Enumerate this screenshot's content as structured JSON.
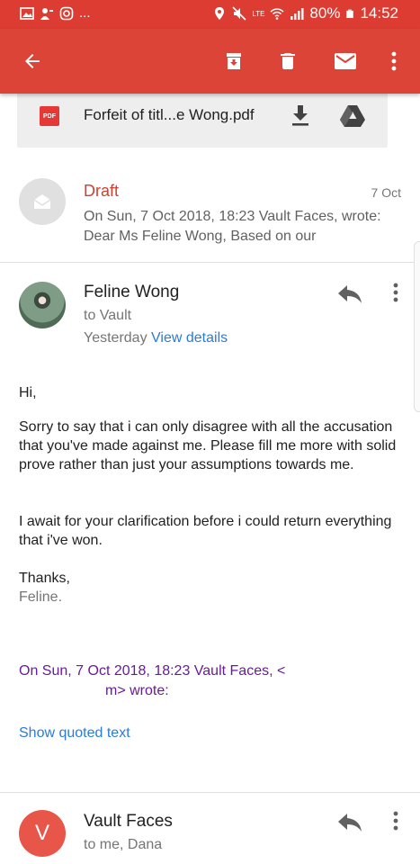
{
  "status_bar": {
    "dots": "...",
    "volte": "LTE",
    "battery": "80%",
    "time": "14:52"
  },
  "app_bar": {
    "back_icon": "arrow-left-icon",
    "archive_icon": "archive-icon",
    "delete_icon": "trash-icon",
    "unread_icon": "mail-icon",
    "more_icon": "more-vert-icon"
  },
  "attachment": {
    "badge": "PDF",
    "name": "Forfeit of titl...e Wong.pdf",
    "download_icon": "download-icon",
    "drive_icon": "drive-icon"
  },
  "draft": {
    "title": "Draft",
    "date": "7 Oct",
    "snippet": "On Sun, 7 Oct 2018, 18:23 Vault Faces, wrote: Dear Ms Feline Wong, Based on our"
  },
  "message": {
    "sender": "Feline Wong",
    "to": "to Vault",
    "when": "Yesterday",
    "view_details": "View details",
    "greeting": "Hi,",
    "paragraph1": "Sorry to say that i can only disagree with all the accusation that you've made against me. Please fill me more with solid prove rather than just your assumptions towards me.",
    "paragraph2": "I await for your clarification before i could return everything that i've won.",
    "closing": "Thanks,",
    "signature": "Feline.",
    "quoted_line1": "On Sun, 7 Oct 2018, 18:23 Vault Faces, <",
    "quoted_line2": "m> wrote:",
    "show_quoted": "Show quoted text"
  },
  "next_message": {
    "avatar_letter": "V",
    "sender": "Vault Faces",
    "to": "to me, Dana"
  },
  "colors": {
    "app_bar": "#db4437",
    "status_bar": "#dd3c32",
    "link": "#2b7bd8",
    "draft": "#d23f31",
    "quoted": "#6a1b9a"
  }
}
